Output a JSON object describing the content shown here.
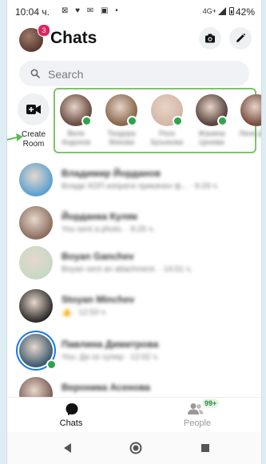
{
  "status_bar": {
    "time": "10:04 ч.",
    "left_icons": "⊠ ♥ ✉ ▣ •",
    "network": "4G+",
    "battery": "42%"
  },
  "header": {
    "title": "Chats",
    "notification_count": "3"
  },
  "search": {
    "placeholder": "Search"
  },
  "create_room": {
    "label": "Create Room"
  },
  "stories": [
    {
      "name": "Вели Андонов",
      "color": "#6b4f45"
    },
    {
      "name": "Теодора Жекова",
      "color": "#8a6a50"
    },
    {
      "name": "Роси Брънкова",
      "color": "#d4b8a8"
    },
    {
      "name": "Жанина Цонева",
      "color": "#5b4640"
    },
    {
      "name": "Лени Дако",
      "color": "#7a5040"
    }
  ],
  "chats": [
    {
      "name": "Владимир Йорданов",
      "message": "Влади ХОП изпрати прикачен ф... · 9:29 ч.",
      "color": "#5aa0d0",
      "online": false,
      "ring": false
    },
    {
      "name": "Йорданка Куляк",
      "message": "You sent a photo. · 9:25 ч.",
      "color": "#8a6d5e",
      "online": false,
      "ring": false
    },
    {
      "name": "Boyan Ganchev",
      "message": "Boyan sent an attachment. · 14:01 ч.",
      "color": "#c7d8c4",
      "online": false,
      "ring": false
    },
    {
      "name": "Stoyan Minchev",
      "message": "👍 · 12:53 ч.",
      "color": "#2c2a28",
      "online": false,
      "ring": false
    },
    {
      "name": "Павлина Димитрова",
      "message": "You: Да се супер · 12:02 ч.",
      "color": "#3d5a6e",
      "online": true,
      "ring": true
    },
    {
      "name": "Вероника Асенова",
      "message": "",
      "color": "#7a5a52",
      "online": false,
      "ring": false
    }
  ],
  "tabs": {
    "chats_label": "Chats",
    "people_label": "People",
    "people_badge": "99+"
  },
  "colors": {
    "accent": "#1877f2",
    "online": "#31a24c",
    "badge": "#e0245e",
    "highlight_box": "#7cc36a"
  }
}
